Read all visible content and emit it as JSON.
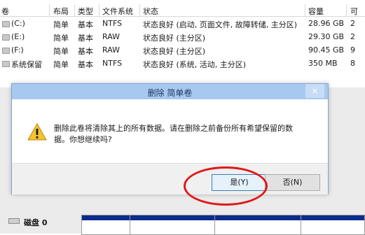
{
  "table": {
    "headers": [
      "卷",
      "布局",
      "类型",
      "文件系统",
      "状态",
      "容量",
      "可"
    ],
    "rows": [
      {
        "volume": "(C:)",
        "layout": "简单",
        "type": "基本",
        "fs": "NTFS",
        "status": "状态良好 (启动, 页面文件, 故障转储, 主分区)",
        "capacity": "28.96 GB",
        "extra": "2"
      },
      {
        "volume": "(E:)",
        "layout": "简单",
        "type": "基本",
        "fs": "RAW",
        "status": "状态良好 (主分区)",
        "capacity": "29.30 GB",
        "extra": "2"
      },
      {
        "volume": "(F:)",
        "layout": "简单",
        "type": "基本",
        "fs": "RAW",
        "status": "状态良好 (主分区)",
        "capacity": "90.45 GB",
        "extra": "9"
      },
      {
        "volume": "系统保留",
        "layout": "简单",
        "type": "基本",
        "fs": "NTFS",
        "status": "状态良好 (系统, 活动, 主分区)",
        "capacity": "350 MB",
        "extra": "8"
      }
    ]
  },
  "dialog": {
    "title": "删除 简单卷",
    "close_symbol": "×",
    "message": "删除此卷将清除其上的所有数据。请在删除之前备份所有希望保留的数据。你想继续吗?",
    "yes_label": "是(Y)",
    "no_label": "否(N)"
  },
  "disk": {
    "label": "磁盘 0"
  },
  "colors": {
    "title_bar": "#a8c9ef",
    "partition_bar": "#0c2c8c",
    "annotation_circle": "#e01818"
  }
}
